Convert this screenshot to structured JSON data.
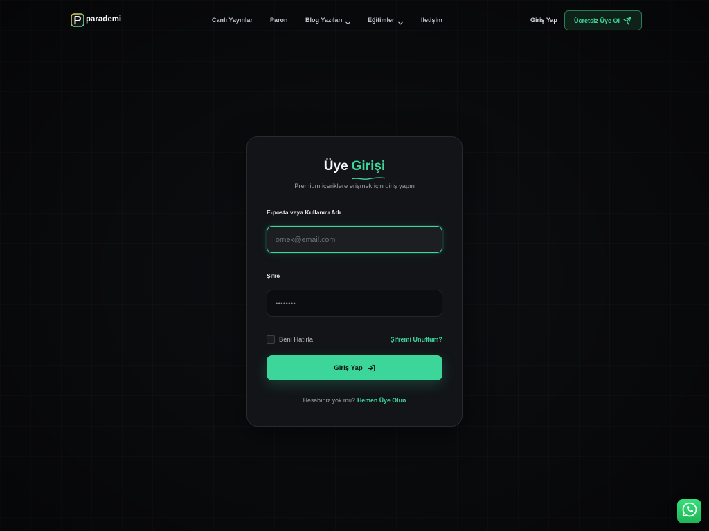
{
  "brand": {
    "name": "parademi",
    "logo_icon": "parademi-logo-icon"
  },
  "nav": {
    "items": [
      {
        "label": "Canlı Yayınlar",
        "has_dropdown": false
      },
      {
        "label": "Paron",
        "has_dropdown": false
      },
      {
        "label": "Blog Yazıları",
        "has_dropdown": true
      },
      {
        "label": "Eğitimler",
        "has_dropdown": true
      },
      {
        "label": "İletişim",
        "has_dropdown": false
      }
    ],
    "login_label": "Giriş Yap",
    "signup_label": "Ücretsiz Üye Ol",
    "signup_icon": "paper-plane-icon"
  },
  "login_card": {
    "title_plain": "Üye",
    "title_accent": "Girişi",
    "subtitle": "Premium içeriklere erişmek için giriş yapın",
    "email_label": "E-posta veya Kullanıcı Adı",
    "email_placeholder": "ornek@email.com",
    "password_label": "Şifre",
    "password_placeholder": "••••••••",
    "remember_label": "Beni Hatırla",
    "remember_checked": false,
    "forgot_label": "Şifremi Unuttum?",
    "submit_label": "Giriş Yap",
    "submit_icon": "login-arrow-icon",
    "signup_prompt": "Hesabınız yok mu?",
    "signup_link": "Hemen Üye Olun"
  },
  "whatsapp": {
    "icon": "whatsapp-icon"
  },
  "colors": {
    "background": "#0a0b0d",
    "card": "#121418",
    "accent": "#3fd69c",
    "whatsapp": "#25d366"
  }
}
